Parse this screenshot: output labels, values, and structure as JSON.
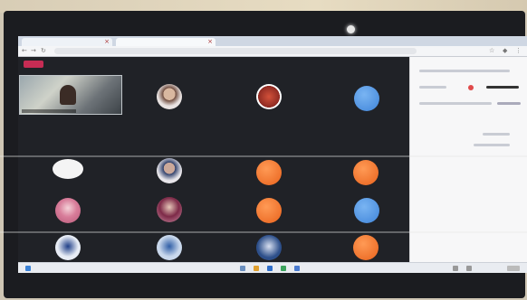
{
  "meeting": {
    "participants": [
      {
        "name": "video-tile"
      },
      {
        "name": "photo-avatar"
      },
      {
        "name": "photo-avatar"
      },
      {
        "name": "blue-avatar"
      },
      {
        "name": "white-avatar"
      },
      {
        "name": "photo-avatar"
      },
      {
        "name": "orange-avatar"
      },
      {
        "name": "orange-avatar"
      },
      {
        "name": "photo-avatar"
      },
      {
        "name": "photo-avatar"
      },
      {
        "name": "orange-avatar"
      },
      {
        "name": "blue-avatar"
      },
      {
        "name": "photo-avatar"
      },
      {
        "name": "photo-avatar"
      },
      {
        "name": "photo-avatar"
      },
      {
        "name": "orange-avatar"
      }
    ]
  },
  "colors": {
    "recording": "#c62c54",
    "avatar_orange": "#f07a32",
    "avatar_blue": "#4f93e2",
    "meeting_bg": "#202227"
  }
}
